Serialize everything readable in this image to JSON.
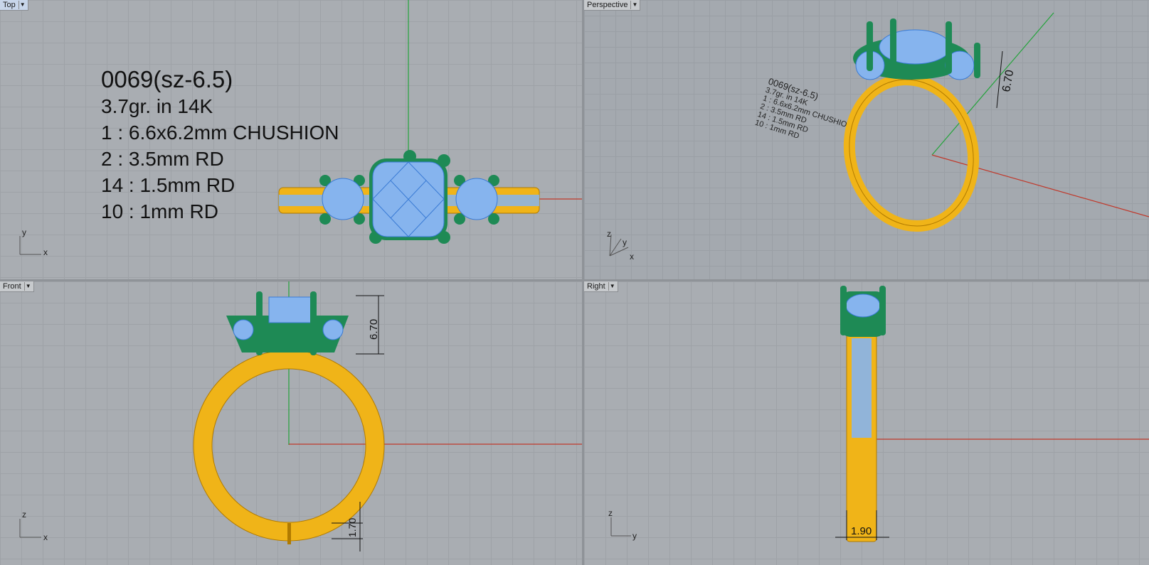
{
  "viewports": {
    "top": {
      "label": "Top",
      "active": true
    },
    "perspective": {
      "label": "Perspective"
    },
    "front": {
      "label": "Front"
    },
    "right": {
      "label": "Right"
    }
  },
  "annotation": {
    "lines": [
      "0069(sz-6.5)",
      "3.7gr.  in 14K",
      "1 : 6.6x6.2mm CHUSHION",
      "2 : 3.5mm RD",
      "14 : 1.5mm RD",
      "10  : 1mm RD"
    ]
  },
  "dimensions": {
    "head_height": "6.70",
    "shank_thickness": "1.70",
    "shank_width": "1.90"
  },
  "axes": {
    "x": "x",
    "y": "y",
    "z": "z"
  },
  "colors": {
    "gold": "#f0b418",
    "prongs": "#1e8a55",
    "gems": "#86b4ee",
    "x_axis": "#c0392b",
    "y_axis": "#22a33a"
  }
}
